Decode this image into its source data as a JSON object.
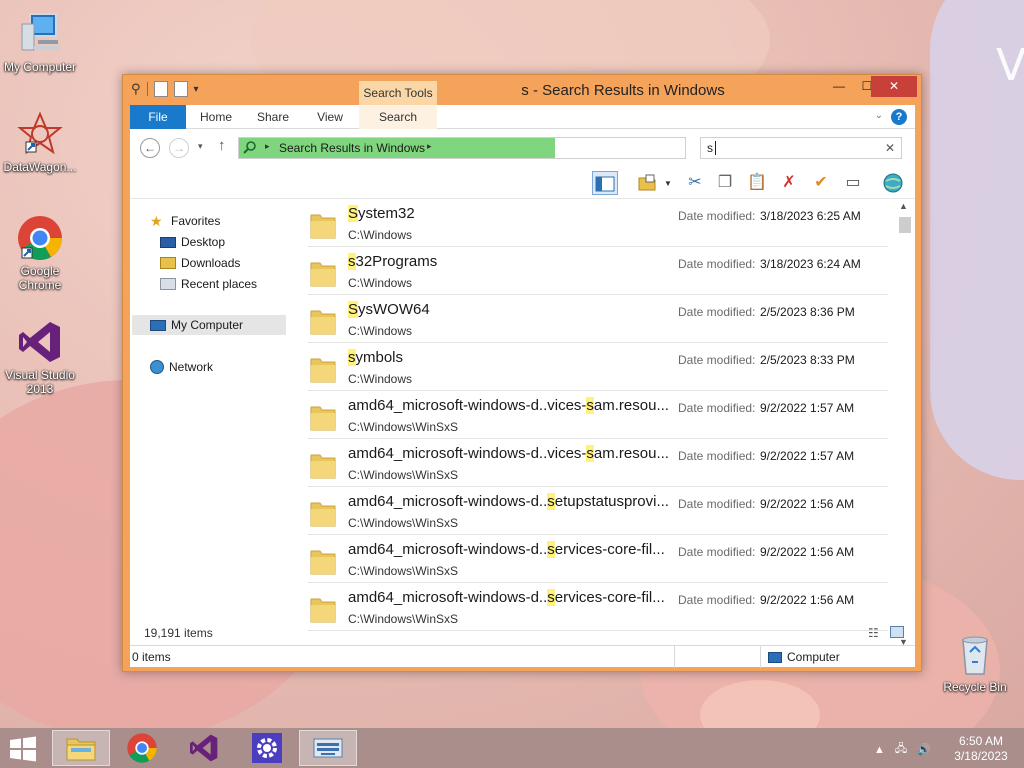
{
  "desktop": {
    "icons": [
      {
        "label": "My Computer"
      },
      {
        "label": "DataWagon..."
      },
      {
        "label": "Google Chrome"
      },
      {
        "label": "Visual Studio 2013"
      },
      {
        "label": "Recycle Bin"
      }
    ],
    "wallpaper_text": "V"
  },
  "window": {
    "title": "s - Search Results in Windows",
    "context_tab": "Search Tools",
    "controls": {
      "minimize": "—",
      "maximize": "☐",
      "close": "✕"
    },
    "ribbon_tabs": [
      {
        "label": "File"
      },
      {
        "label": "Home"
      },
      {
        "label": "Share"
      },
      {
        "label": "View"
      },
      {
        "label": "Search"
      }
    ],
    "address": {
      "text": "Search Results in Windows"
    },
    "search": {
      "value": "s"
    },
    "nav_pane": {
      "favorites": "Favorites",
      "desktop": "Desktop",
      "downloads": "Downloads",
      "recent_places": "Recent places",
      "my_computer": "My Computer",
      "network": "Network"
    },
    "date_label": "Date modified:",
    "files": [
      {
        "pre": "",
        "hl": "S",
        "post": "ystem32",
        "path": "C:\\Windows",
        "date": "3/18/2023 6:25 AM"
      },
      {
        "pre": "",
        "hl": "s",
        "post": "32Programs",
        "path": "C:\\Windows",
        "date": "3/18/2023 6:24 AM"
      },
      {
        "pre": "",
        "hl": "S",
        "post": "ysWOW64",
        "path": "C:\\Windows",
        "date": "2/5/2023 8:36 PM"
      },
      {
        "pre": "",
        "hl": "s",
        "post": "ymbols",
        "path": "C:\\Windows",
        "date": "2/5/2023 8:33 PM"
      },
      {
        "pre": "amd64_microsoft-windows-d..vices-",
        "hl": "s",
        "post": "am.resou...",
        "path": "C:\\Windows\\WinSxS",
        "date": "9/2/2022 1:57 AM"
      },
      {
        "pre": "amd64_microsoft-windows-d..vices-",
        "hl": "s",
        "post": "am.resou...",
        "path": "C:\\Windows\\WinSxS",
        "date": "9/2/2022 1:57 AM"
      },
      {
        "pre": "amd64_microsoft-windows-d..",
        "hl": "s",
        "post": "etupstatusprovi...",
        "path": "C:\\Windows\\WinSxS",
        "date": "9/2/2022 1:56 AM"
      },
      {
        "pre": "amd64_microsoft-windows-d..",
        "hl": "s",
        "post": "ervices-core-fil...",
        "path": "C:\\Windows\\WinSxS",
        "date": "9/2/2022 1:56 AM"
      },
      {
        "pre": "amd64_microsoft-windows-d..",
        "hl": "s",
        "post": "ervices-core-fil...",
        "path": "C:\\Windows\\WinSxS",
        "date": "9/2/2022 1:56 AM"
      }
    ],
    "items_count": "19,191 items",
    "status": {
      "items": "0 items",
      "zone": "Computer"
    }
  },
  "taskbar": {
    "apps": [
      {
        "name": "File Explorer",
        "active": true
      },
      {
        "name": "Google Chrome",
        "active": false
      },
      {
        "name": "Visual Studio",
        "active": false
      },
      {
        "name": "Settings",
        "active": false
      },
      {
        "name": "On-Screen Keyboard",
        "active": false
      }
    ],
    "clock": {
      "time": "6:50 AM",
      "date": "3/18/2023"
    }
  },
  "colors": {
    "window_frame": "#f5a35a",
    "file_tab": "#1979ca",
    "address_highlight": "#7fd67e",
    "search_highlight": "#fff17a",
    "close_button": "#c7403a"
  }
}
